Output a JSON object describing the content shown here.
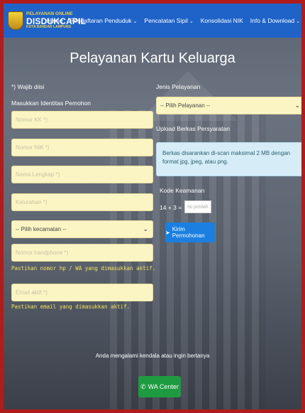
{
  "brand": {
    "line1": "PELAYANAN ONLINE",
    "line2": "DISDUKCAPIL",
    "line3": "KOTA BANDAR LAMPUNG"
  },
  "nav": {
    "home": "Home",
    "pendaftaran": "Pendaftaran Penduduk",
    "pencatatan": "Pencatatan Sipil",
    "konsolidasi": "Konsolidasi NIK",
    "info": "Info & Download",
    "caret": "⌄"
  },
  "page_title": "Pelayanan Kartu Keluarga",
  "form": {
    "required_note": "*) Wajib diisi",
    "identity_label": "Masukkan Identitas Pemohon",
    "nomor_kk": "Nomor KK *)",
    "nomor_nik": "Nomor NIK *)",
    "nama": "Nama Lengkap *)",
    "kelurahan": "Kelurahan *)",
    "kecamatan": "-- Pilih kecamatan --",
    "phone": "Nomor handphone *)",
    "phone_hint": "Pastikan nomor hp / WA yang dimasukkan aktif.",
    "email": "Email aktif *)",
    "email_hint": "Pastikan email yang dimasukkan aktif.",
    "jenis_label": "Jenis Pelayanan",
    "jenis_select": "-- Pilih Pelayanan --",
    "upload_label": "Upload Berkas Persyaratan",
    "upload_info": "Berkas disarankan di-scan maksimal 2 MB dengan format jpg, jpeg, atau png.",
    "captcha_label": "Kode Keamanan",
    "captcha_question": "14 + 3 =",
    "captcha_placeholder": "Isi jumlah",
    "submit": "Kirim Permohonan"
  },
  "footer": {
    "contact_text": "Anda mengalami kendala atau ingin bertanya",
    "wa_button": "WA Center"
  },
  "colors": {
    "navbar": "#1f63c8",
    "input_bg": "#fbf5c4",
    "submit": "#1a7fe0",
    "wa": "#1e9b41",
    "hint": "#f6e25b"
  }
}
